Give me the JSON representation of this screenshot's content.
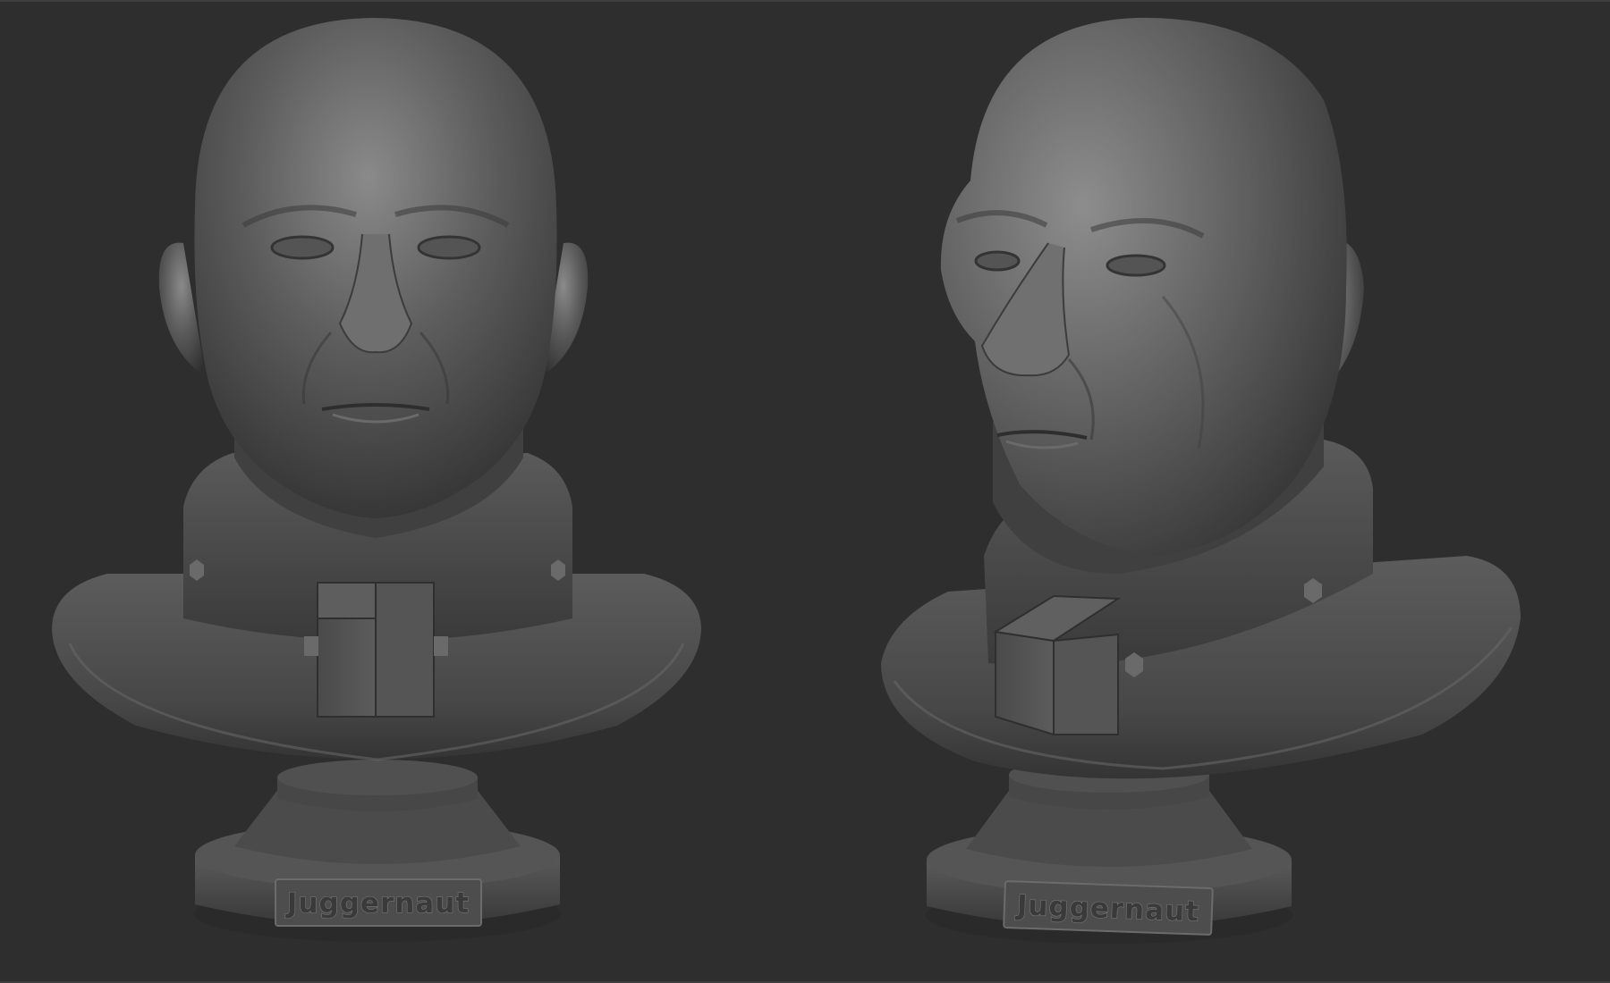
{
  "scene": {
    "background": "#2e2e2f",
    "views": [
      {
        "view": "front",
        "plaque_text": "Juggernaut"
      },
      {
        "view": "three-quarter",
        "plaque_text": "Juggernaut"
      }
    ]
  }
}
